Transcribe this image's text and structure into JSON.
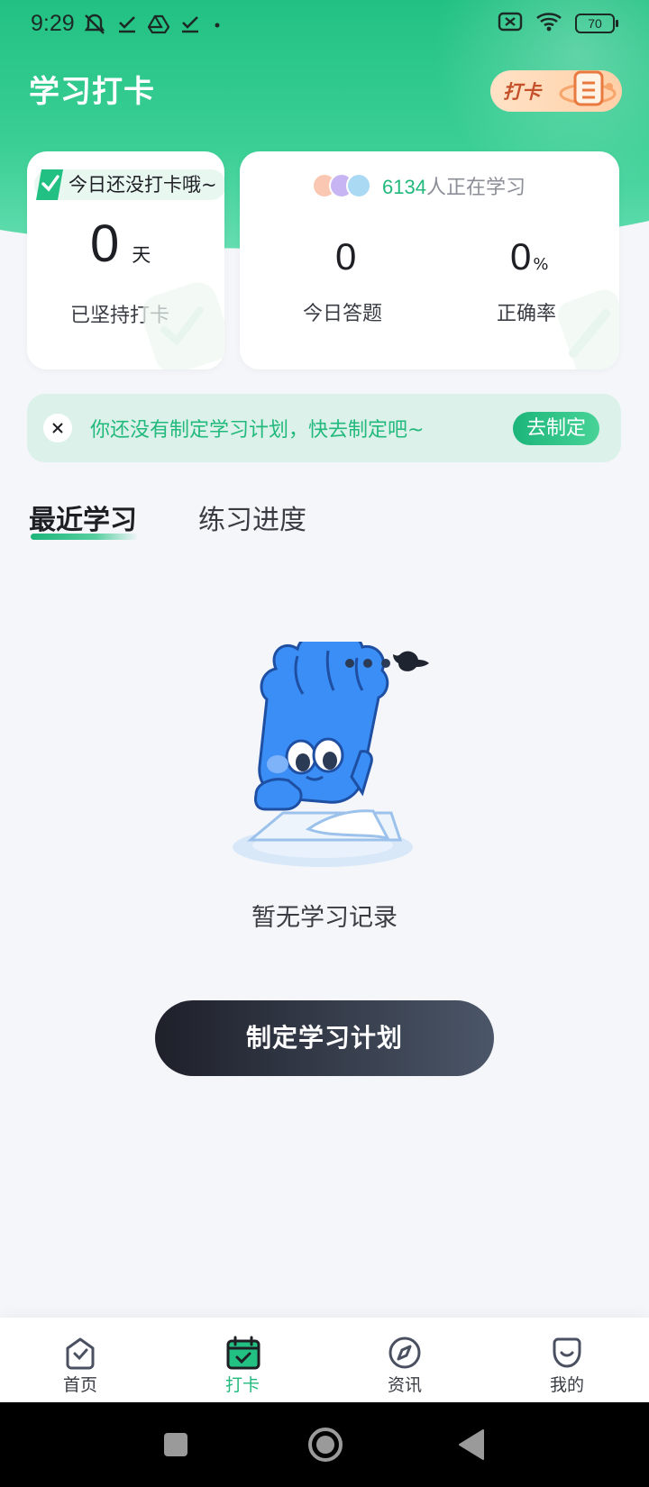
{
  "status_bar": {
    "time": "9:29",
    "left_icons": [
      "muted-bell-icon",
      "download-done-icon",
      "drive-icon",
      "download-done-icon",
      "dot-icon"
    ],
    "right_icons": [
      "no-sim-icon",
      "wifi-icon",
      "battery-icon"
    ],
    "battery": "70"
  },
  "header": {
    "title": "学习打卡",
    "badge_label": "打卡"
  },
  "streak_card": {
    "status_pill": "今日还没打卡哦~",
    "value": "0",
    "unit": "天",
    "label": "已坚持打卡"
  },
  "stats_card": {
    "learners_count": "6134",
    "learners_suffix": "人正在学习",
    "today_questions_value": "0",
    "today_questions_label": "今日答题",
    "accuracy_value": "0",
    "accuracy_unit": "%",
    "accuracy_label": "正确率"
  },
  "plan_banner": {
    "text": "你还没有制定学习计划，快去制定吧~",
    "button": "去制定"
  },
  "tabs": [
    {
      "label": "最近学习",
      "active": true
    },
    {
      "label": "练习进度",
      "active": false
    }
  ],
  "empty_state": {
    "text": "暂无学习记录",
    "button": "制定学习计划"
  },
  "bottom_nav": [
    {
      "label": "首页",
      "icon": "home-icon",
      "active": false
    },
    {
      "label": "打卡",
      "icon": "calendar-check-icon",
      "active": true
    },
    {
      "label": "资讯",
      "icon": "compass-icon",
      "active": false
    },
    {
      "label": "我的",
      "icon": "profile-icon",
      "active": false
    }
  ],
  "colors": {
    "brand_green": "#22b97c",
    "hero_green": "#22c183",
    "banner_bg": "#dbf1e9",
    "cta_dark": "#1e202a",
    "page_bg": "#f5f6fa"
  }
}
